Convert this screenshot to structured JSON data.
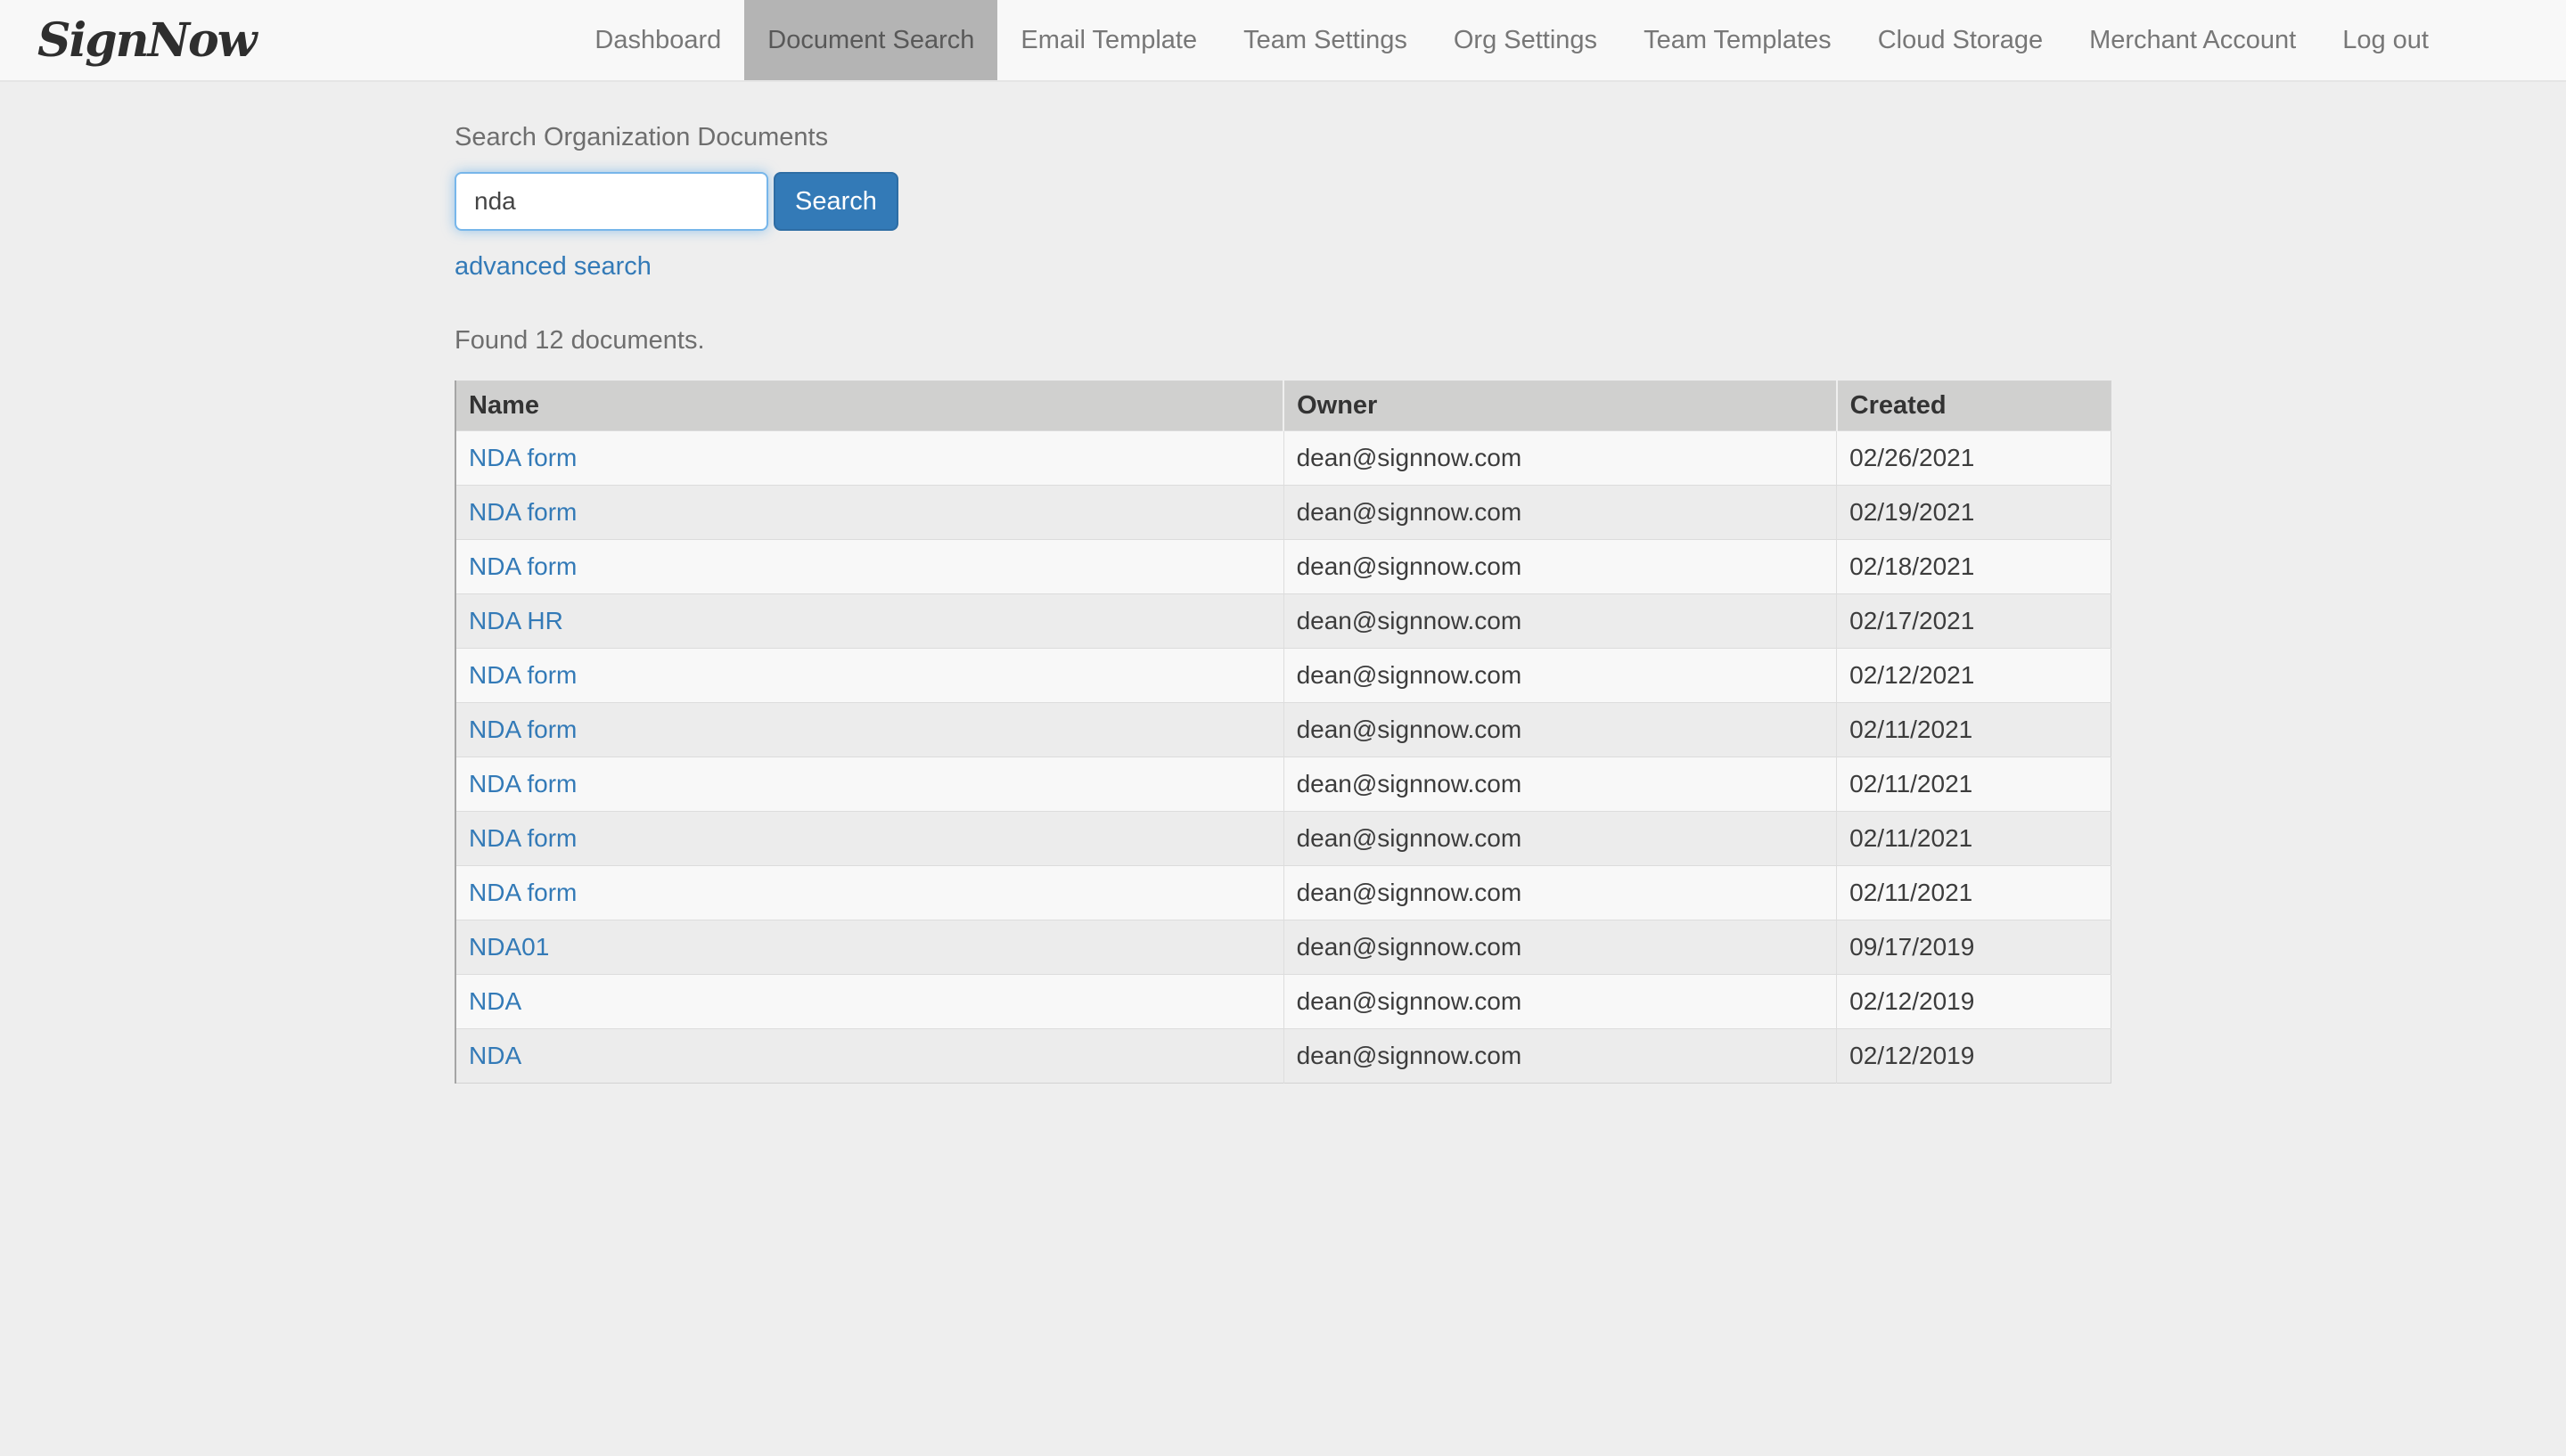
{
  "brand": {
    "logo_text": "SignNow"
  },
  "nav": {
    "items": [
      {
        "label": "Dashboard",
        "active": false
      },
      {
        "label": "Document Search",
        "active": true
      },
      {
        "label": "Email Template",
        "active": false
      },
      {
        "label": "Team Settings",
        "active": false
      },
      {
        "label": "Org Settings",
        "active": false
      },
      {
        "label": "Team Templates",
        "active": false
      },
      {
        "label": "Cloud Storage",
        "active": false
      },
      {
        "label": "Merchant Account",
        "active": false
      },
      {
        "label": "Log out",
        "active": false
      }
    ]
  },
  "search": {
    "label": "Search Organization Documents",
    "input_value": "nda",
    "button_label": "Search",
    "advanced_link": "advanced search"
  },
  "results": {
    "summary": "Found 12 documents."
  },
  "table": {
    "columns": [
      "Name",
      "Owner",
      "Created"
    ],
    "rows": [
      {
        "name": "NDA form",
        "owner": "dean@signnow.com",
        "created": "02/26/2021"
      },
      {
        "name": "NDA form",
        "owner": "dean@signnow.com",
        "created": "02/19/2021"
      },
      {
        "name": "NDA form",
        "owner": "dean@signnow.com",
        "created": "02/18/2021"
      },
      {
        "name": "NDA HR",
        "owner": "dean@signnow.com",
        "created": "02/17/2021"
      },
      {
        "name": "NDA form",
        "owner": "dean@signnow.com",
        "created": "02/12/2021"
      },
      {
        "name": "NDA form",
        "owner": "dean@signnow.com",
        "created": "02/11/2021"
      },
      {
        "name": "NDA form",
        "owner": "dean@signnow.com",
        "created": "02/11/2021"
      },
      {
        "name": "NDA form",
        "owner": "dean@signnow.com",
        "created": "02/11/2021"
      },
      {
        "name": "NDA form",
        "owner": "dean@signnow.com",
        "created": "02/11/2021"
      },
      {
        "name": "NDA01",
        "owner": "dean@signnow.com",
        "created": "09/17/2019"
      },
      {
        "name": "NDA",
        "owner": "dean@signnow.com",
        "created": "02/12/2019"
      },
      {
        "name": "NDA",
        "owner": "dean@signnow.com",
        "created": "02/12/2019"
      }
    ]
  },
  "colors": {
    "accent_blue": "#337ab7",
    "button_border": "#2e6da4",
    "active_tab_bg": "#b4b4b4",
    "navbar_bg": "#f8f8f8",
    "page_bg": "#eeeeee",
    "table_header_bg": "#d0d0cf",
    "row_odd_bg": "#f8f8f8",
    "row_even_bg": "#ececec",
    "input_focus_border": "#66afe9"
  }
}
